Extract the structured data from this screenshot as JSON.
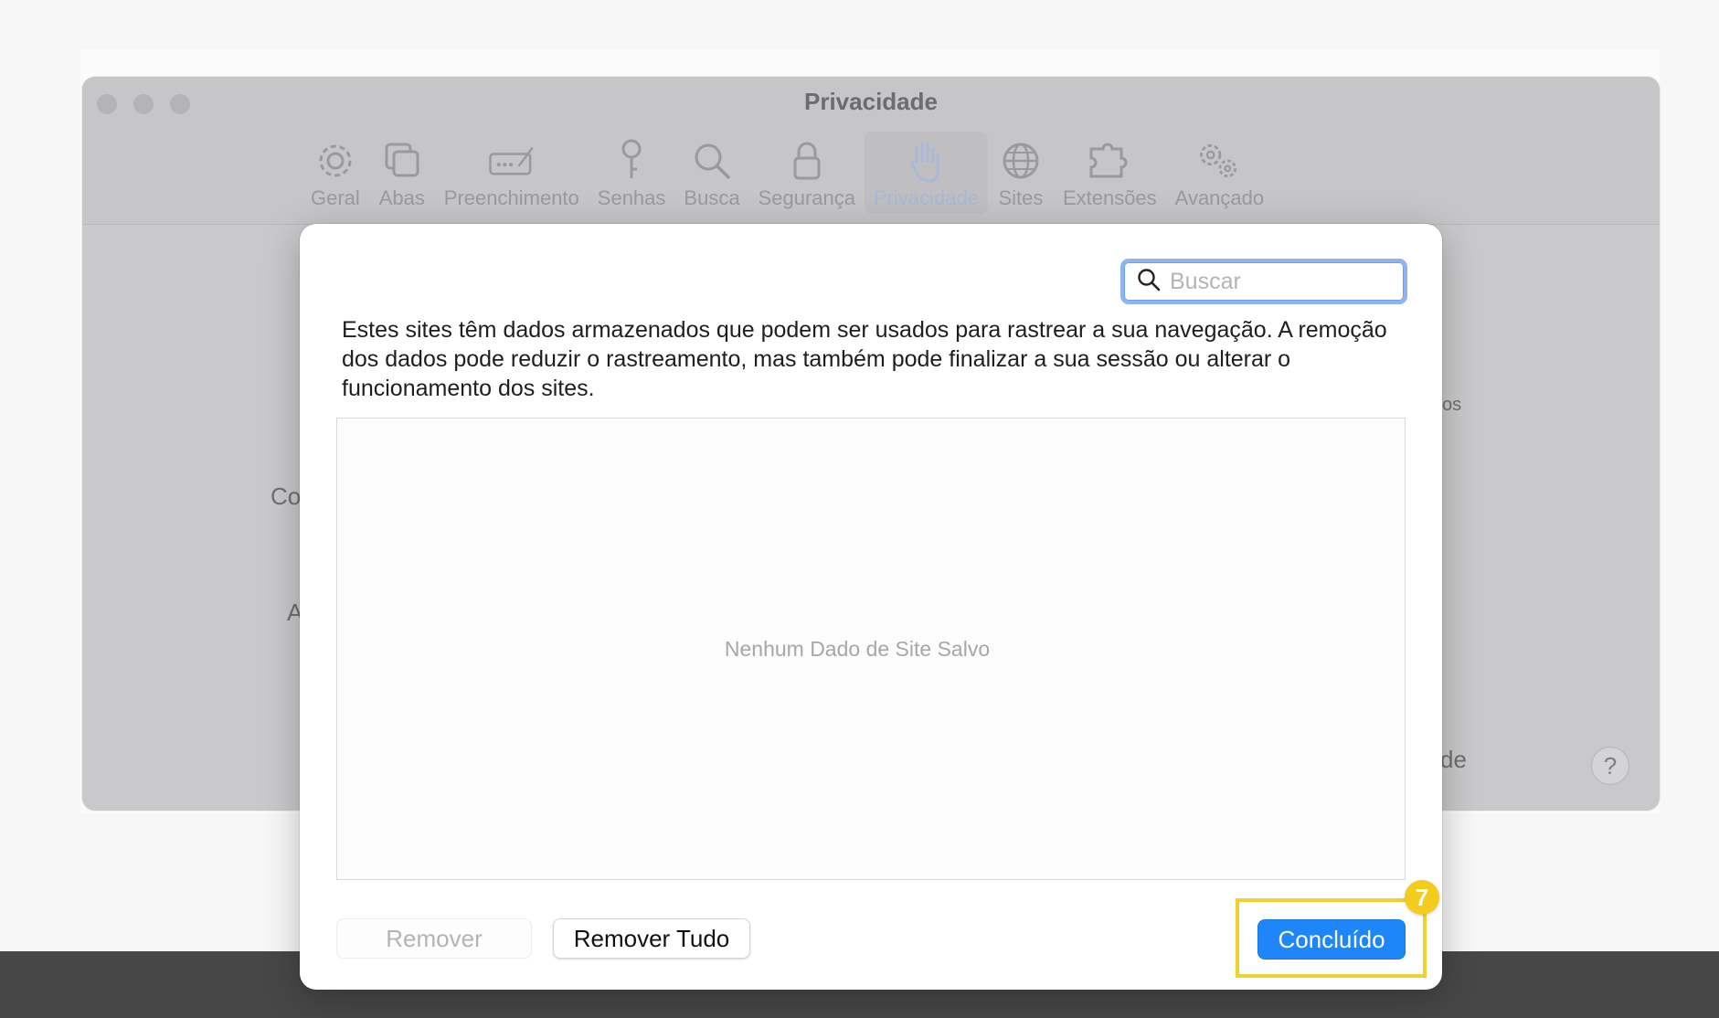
{
  "window": {
    "title": "Privacidade",
    "toolbar": [
      {
        "label": "Geral",
        "icon": "gear-icon"
      },
      {
        "label": "Abas",
        "icon": "tabs-icon"
      },
      {
        "label": "Preenchimento",
        "icon": "autofill-icon"
      },
      {
        "label": "Senhas",
        "icon": "key-icon"
      },
      {
        "label": "Busca",
        "icon": "search-icon"
      },
      {
        "label": "Segurança",
        "icon": "lock-icon"
      },
      {
        "label": "Privacidade",
        "icon": "hand-icon",
        "active": true
      },
      {
        "label": "Sites",
        "icon": "globe-icon"
      },
      {
        "label": "Extensões",
        "icon": "puzzle-icon"
      },
      {
        "label": "Avançado",
        "icon": "gears-icon"
      }
    ],
    "background_text": {
      "left_1": "Co",
      "left_2": "A",
      "right_1": "os",
      "right_2": "de"
    },
    "help": "?"
  },
  "sheet": {
    "search_placeholder": "Buscar",
    "description": "Estes sites têm dados armazenados que podem ser usados para rastrear a sua navegação. A remoção dos dados pode reduzir o rastreamento, mas também pode finalizar a sua sessão ou alterar o funcionamento dos sites.",
    "empty_message": "Nenhum Dado de Site Salvo",
    "buttons": {
      "remove": "Remover",
      "remove_all": "Remover Tudo",
      "done": "Concluído"
    }
  },
  "annotation": {
    "step": "7"
  },
  "colors": {
    "accent": "#1f86f9",
    "highlight": "#f0d12f"
  }
}
